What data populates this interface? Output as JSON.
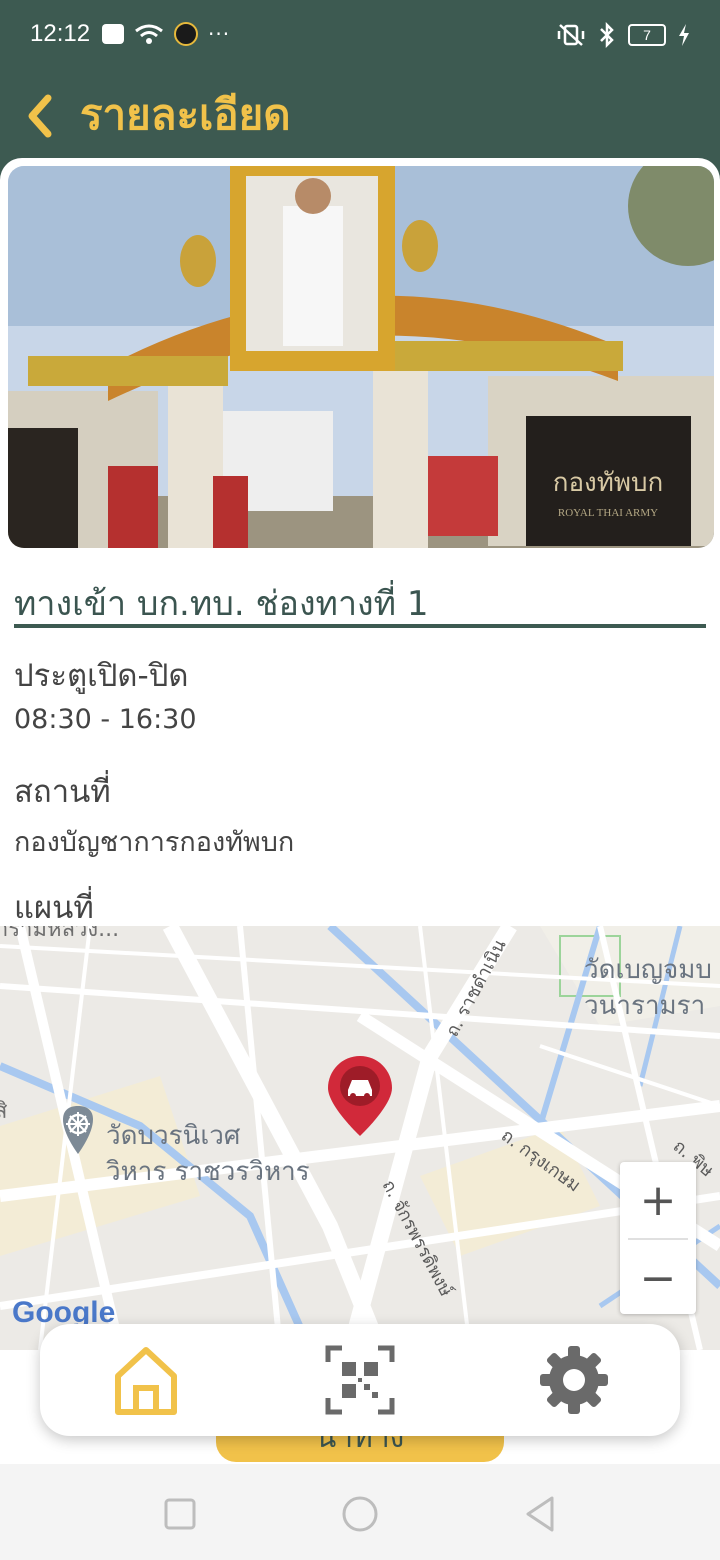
{
  "status_bar": {
    "time": "12:12",
    "more": "···",
    "battery": "7"
  },
  "header": {
    "title": "รายละเอียด",
    "back_icon": "chevron-left-icon"
  },
  "detail": {
    "gate_name": "ทางเข้า บก.ทบ. ช่องทางที่ 1",
    "hours_label": "ประตูเปิด-ปิด",
    "hours_value": "08:30 - 16:30",
    "place_label": "สถานที่",
    "place_value": "กองบัญชาการกองทัพบก",
    "map_label": "แผนที่"
  },
  "hero_image": {
    "sign_text": "กองทัพบก",
    "sign_subtext": "ROYAL THAI ARMY"
  },
  "map": {
    "poi_1_line1": "วัดบวรนิเวศ",
    "poi_1_line2": "วิหาร ราชวรวิหาร",
    "poi_2_line1": "วัดเบญจมบ",
    "poi_2_line2": "วนารามรา",
    "road_1": "ถ. ราชดำเนิน",
    "road_2": "ถ. กรุงเกษม",
    "road_3": "ถ. จักรพรรดิพงษ์",
    "road_4": "ถ. พิษ",
    "top_fragment": "ารามหลวง...",
    "left_fragment": "สิ",
    "zoom_in": "+",
    "zoom_out": "−",
    "google": "Google",
    "marker_icon": "car-marker-icon"
  },
  "bottom_nav": {
    "items": [
      {
        "icon": "home-icon",
        "active": true
      },
      {
        "icon": "qr-scan-icon",
        "active": false
      },
      {
        "icon": "settings-gear-icon",
        "active": false
      }
    ],
    "hidden_button_label": "นำทาง"
  },
  "colors": {
    "primary_dark": "#3d5a51",
    "accent_yellow": "#f1c24a",
    "marker_red": "#d1293a"
  }
}
